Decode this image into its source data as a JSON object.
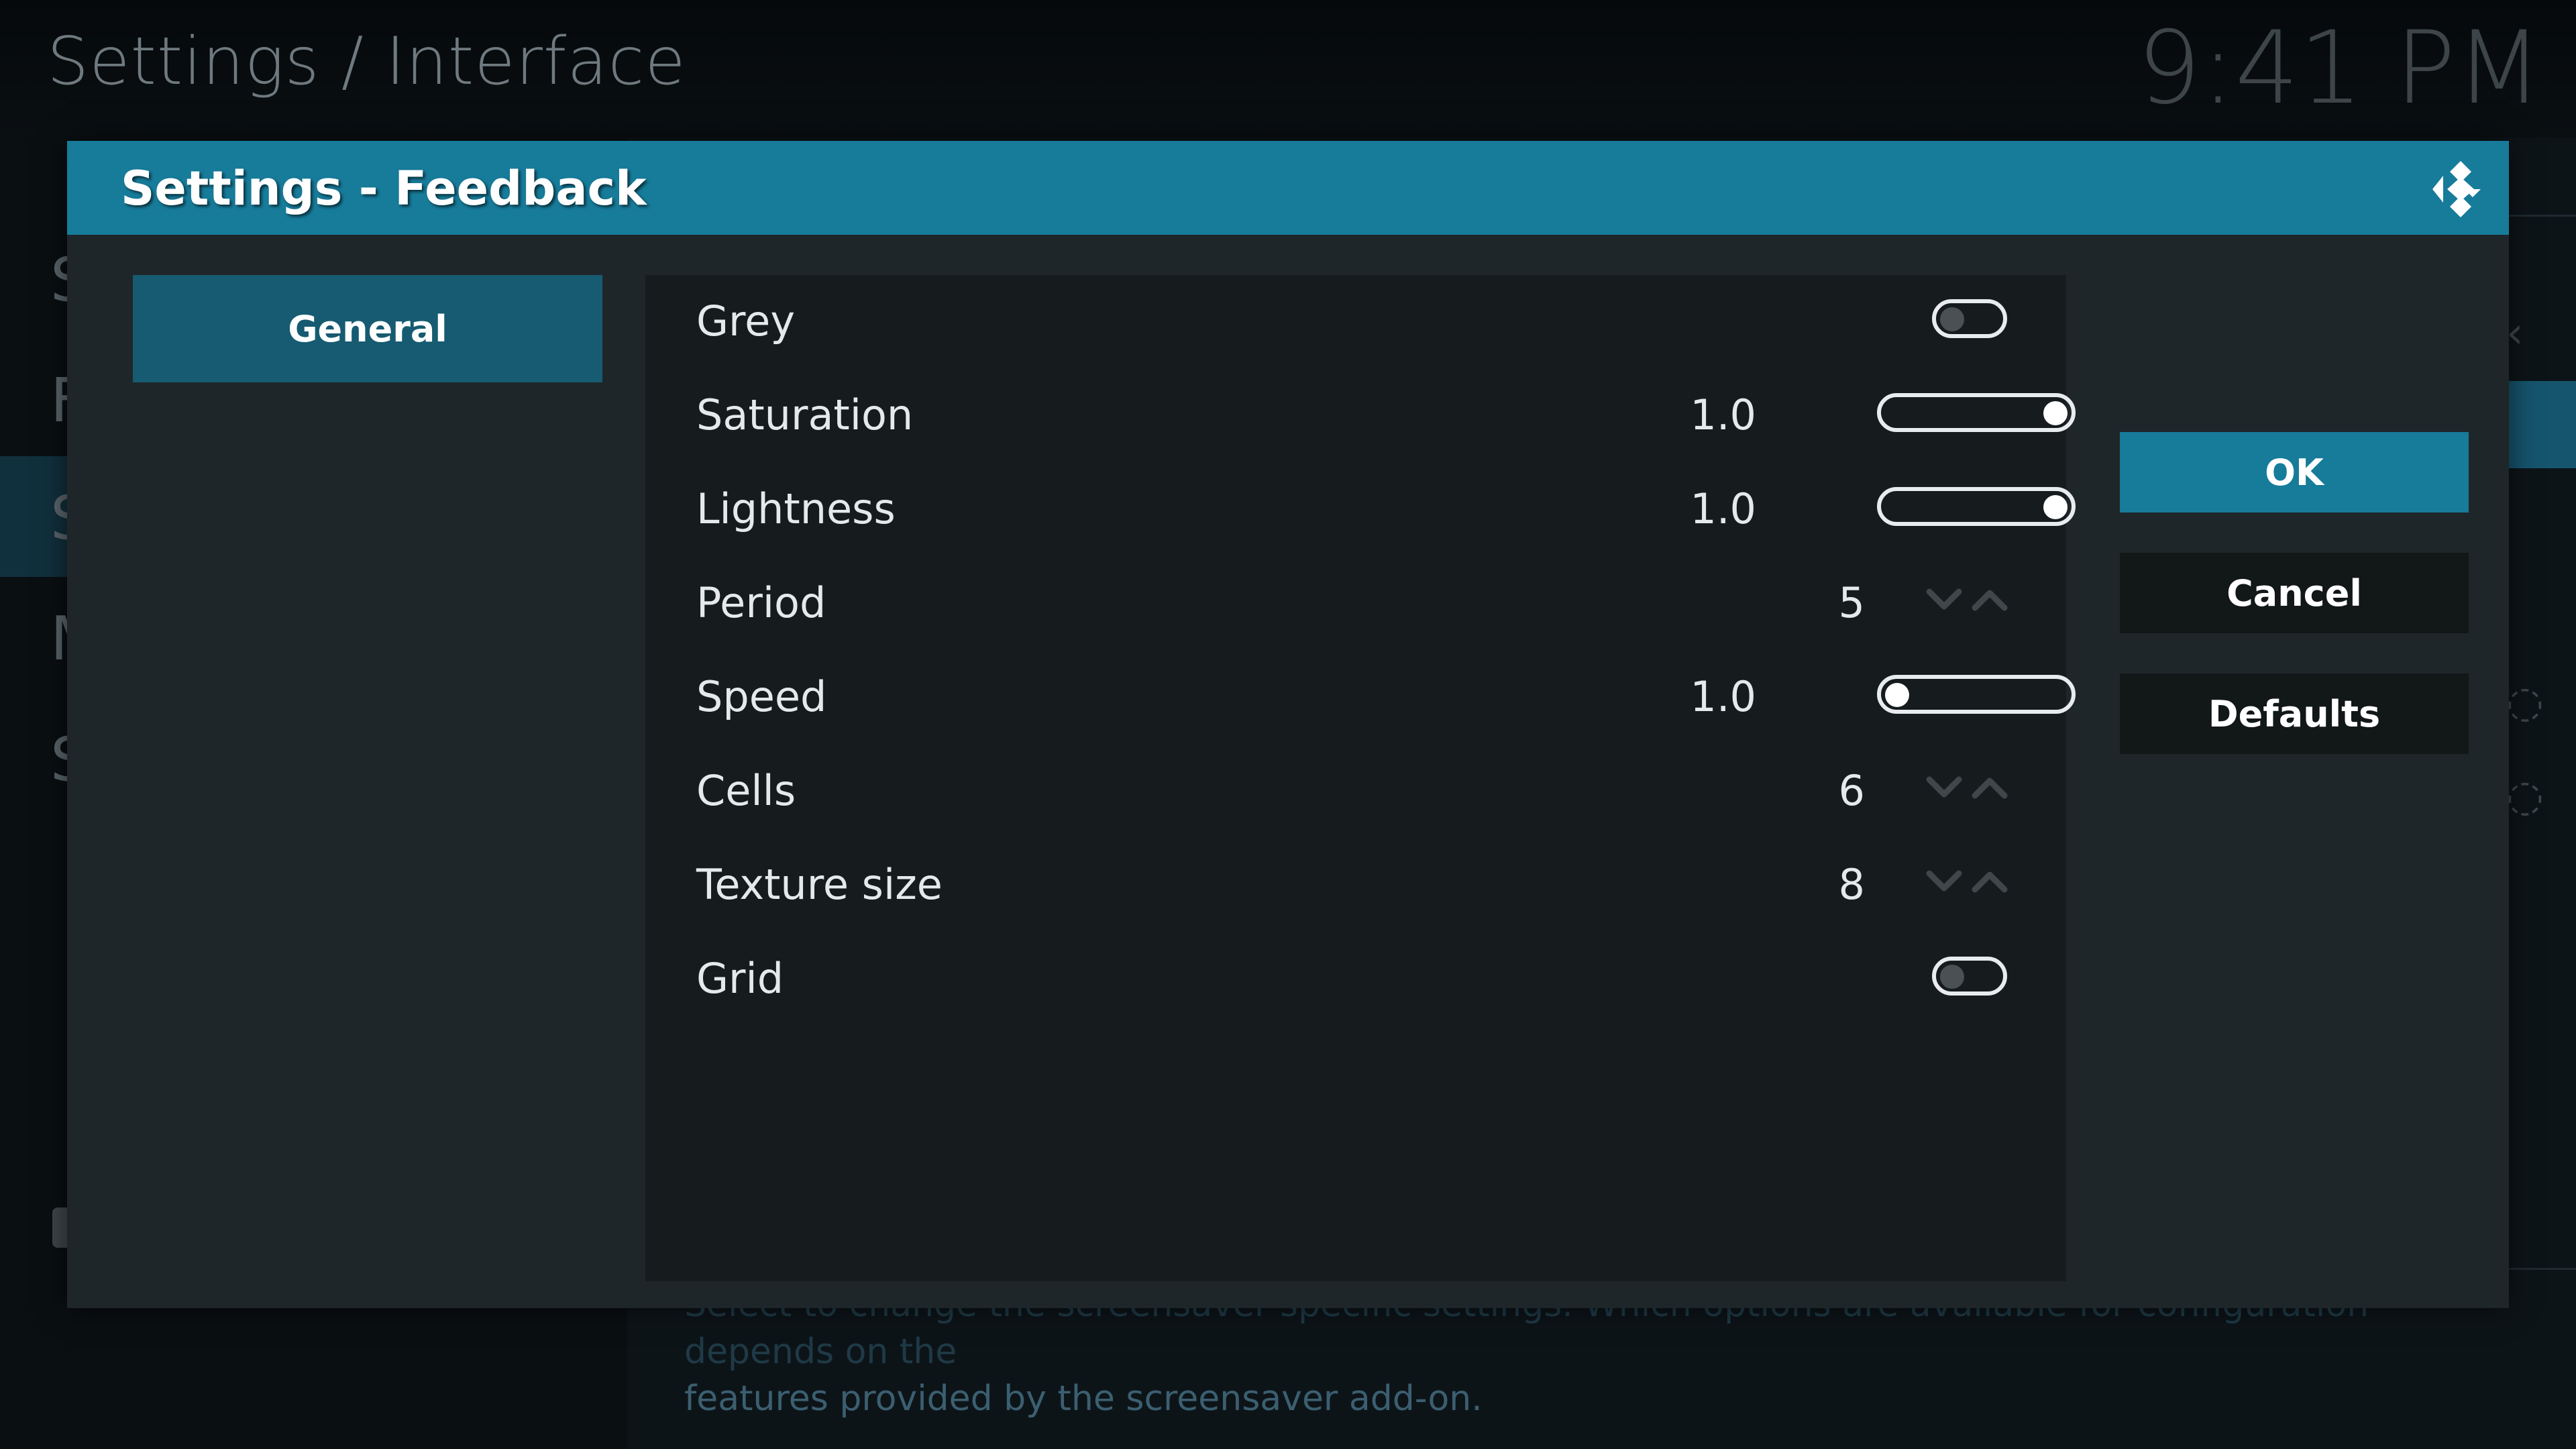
{
  "background": {
    "breadcrumb": "Settings / Interface",
    "clock": "9:41 PM",
    "menu_letters": [
      "S",
      "F",
      "S",
      "M",
      "S"
    ],
    "description_part1": "Select to change the screensaver specific settings. Which options are available for configuration depends on the",
    "description_part2": "features provided by the screensaver add-on."
  },
  "dialog": {
    "title": "Settings - Feedback",
    "logo_icon": "kodi-logo-icon",
    "categories": [
      {
        "label": "General"
      }
    ],
    "settings": [
      {
        "label": "Grey",
        "control": "toggle",
        "enabled": false
      },
      {
        "label": "Saturation",
        "control": "slider",
        "value": "1.0",
        "level": 1.0
      },
      {
        "label": "Lightness",
        "control": "slider",
        "value": "1.0",
        "level": 1.0
      },
      {
        "label": "Period",
        "control": "spinner",
        "value": "5"
      },
      {
        "label": "Speed",
        "control": "slider",
        "value": "1.0",
        "level": 0.0
      },
      {
        "label": "Cells",
        "control": "spinner",
        "value": "6"
      },
      {
        "label": "Texture size",
        "control": "spinner",
        "value": "8"
      },
      {
        "label": "Grid",
        "control": "toggle",
        "enabled": false
      }
    ],
    "buttons": {
      "ok": "OK",
      "cancel": "Cancel",
      "defaults": "Defaults"
    }
  },
  "colors": {
    "accent": "#177b9a",
    "tab_selected": "#165b71",
    "panel": "#161c1e",
    "dialog_bg": "#1f2629"
  }
}
